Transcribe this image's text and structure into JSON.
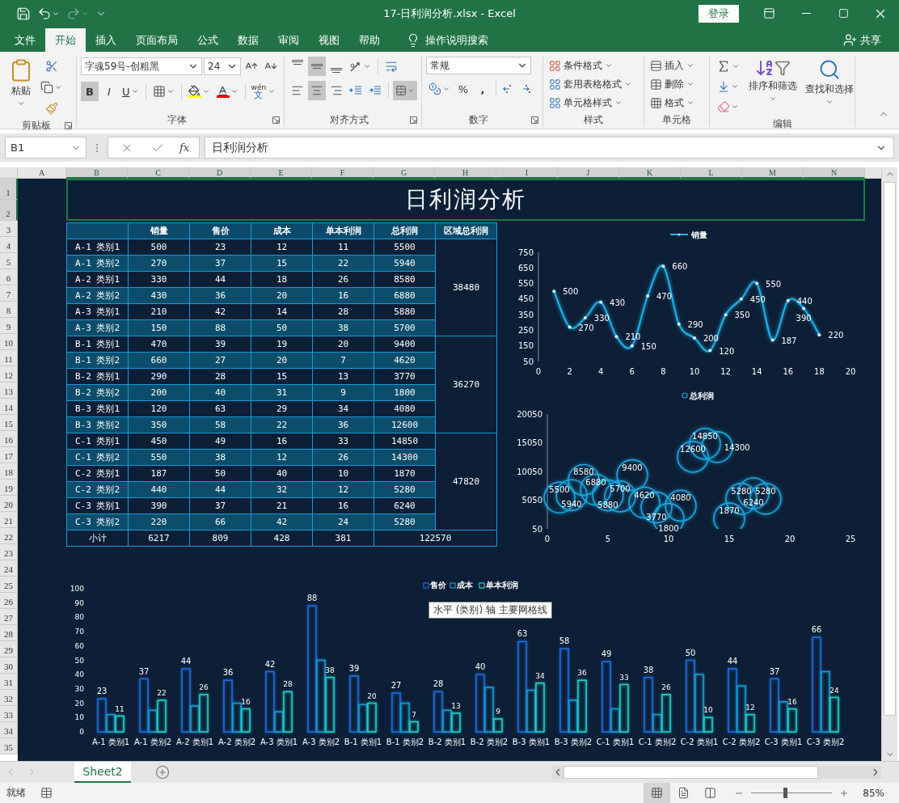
{
  "title_bar": {
    "title": "17-日利润分析.xlsx  -  Excel",
    "sign_in": "登录",
    "redo_disabled": true
  },
  "menu_tabs": [
    {
      "label": "文件",
      "selected": false
    },
    {
      "label": "开始",
      "selected": true
    },
    {
      "label": "插入",
      "selected": false
    },
    {
      "label": "页面布局",
      "selected": false
    },
    {
      "label": "公式",
      "selected": false
    },
    {
      "label": "数据",
      "selected": false
    },
    {
      "label": "审阅",
      "selected": false
    },
    {
      "label": "视图",
      "selected": false
    },
    {
      "label": "帮助",
      "selected": false
    }
  ],
  "tell_me": "操作说明搜索",
  "share": "共享",
  "ribbon": {
    "clipboard": {
      "label": "剪贴板",
      "paste": "粘贴"
    },
    "font": {
      "label": "字体",
      "font_name": "字魂59号-创粗黑",
      "font_size": "24",
      "styles": [
        {
          "label": "B",
          "kind": "bold",
          "selected": true
        },
        {
          "label": "I",
          "kind": "italic",
          "selected": false
        },
        {
          "label": "U",
          "kind": "underline",
          "selected": false
        }
      ],
      "phonetic": {
        "top": "wén",
        "bottom": "文"
      }
    },
    "alignment": {
      "label": "对齐方式",
      "vertical": [
        {
          "kind": "top",
          "selected": false
        },
        {
          "kind": "middle",
          "selected": true
        },
        {
          "kind": "bottom",
          "selected": false
        }
      ],
      "horizontal": [
        {
          "kind": "left",
          "selected": false
        },
        {
          "kind": "center",
          "selected": true
        },
        {
          "kind": "right",
          "selected": false
        }
      ],
      "merge_selected": true
    },
    "number": {
      "label": "数字",
      "format": "常规",
      "percent": "%",
      "comma": ","
    },
    "styles": {
      "label": "样式",
      "items": [
        "条件格式",
        "套用表格格式",
        "单元格样式"
      ]
    },
    "cells": {
      "label": "单元格",
      "items": [
        "插入",
        "删除",
        "格式"
      ]
    },
    "editing": {
      "label": "编辑",
      "sort": "排序和筛选",
      "find": "查找和选择"
    }
  },
  "formula_bar": {
    "name_box": "B1",
    "fx": "fx",
    "formula": "日利润分析"
  },
  "columns": [
    {
      "label": "A",
      "selected": false
    },
    {
      "label": "B",
      "selected": true
    },
    {
      "label": "C",
      "selected": true
    },
    {
      "label": "D",
      "selected": true
    },
    {
      "label": "E",
      "selected": true
    },
    {
      "label": "F",
      "selected": true
    },
    {
      "label": "G",
      "selected": true
    },
    {
      "label": "H",
      "selected": true
    },
    {
      "label": "I",
      "selected": true
    },
    {
      "label": "J",
      "selected": true
    },
    {
      "label": "K",
      "selected": true
    },
    {
      "label": "L",
      "selected": true
    },
    {
      "label": "M",
      "selected": true
    },
    {
      "label": "N",
      "selected": true
    }
  ],
  "rows": [
    {
      "label": "1",
      "selected": true
    },
    {
      "label": "2",
      "selected": true
    },
    {
      "label": "3",
      "selected": false
    },
    {
      "label": "4",
      "selected": false
    },
    {
      "label": "5",
      "selected": false
    },
    {
      "label": "6",
      "selected": false
    },
    {
      "label": "7",
      "selected": false
    },
    {
      "label": "8",
      "selected": false
    },
    {
      "label": "9",
      "selected": false
    },
    {
      "label": "10",
      "selected": false
    },
    {
      "label": "11",
      "selected": false
    },
    {
      "label": "12",
      "selected": false
    },
    {
      "label": "13",
      "selected": false
    },
    {
      "label": "14",
      "selected": false
    },
    {
      "label": "15",
      "selected": false
    },
    {
      "label": "16",
      "selected": false
    },
    {
      "label": "17",
      "selected": false
    },
    {
      "label": "18",
      "selected": false
    },
    {
      "label": "19",
      "selected": false
    },
    {
      "label": "20",
      "selected": false
    },
    {
      "label": "21",
      "selected": false
    },
    {
      "label": "22",
      "selected": false
    },
    {
      "label": "23",
      "selected": false
    },
    {
      "label": "24",
      "selected": false
    },
    {
      "label": "25",
      "selected": false
    },
    {
      "label": "26",
      "selected": false
    },
    {
      "label": "27",
      "selected": false
    },
    {
      "label": "28",
      "selected": false
    },
    {
      "label": "29",
      "selected": false
    },
    {
      "label": "30",
      "selected": false
    },
    {
      "label": "31",
      "selected": false
    },
    {
      "label": "32",
      "selected": false
    },
    {
      "label": "33",
      "selected": false
    },
    {
      "label": "34",
      "selected": false
    },
    {
      "label": "35",
      "selected": false
    }
  ],
  "sheet_title": {
    "text": "日利润分析",
    "selected": true
  },
  "table": {
    "columns": [
      "销量",
      "售价",
      "成本",
      "单本利润",
      "总利润",
      "区域总利润"
    ],
    "regions": [
      {
        "total": "38480",
        "rows": [
          {
            "label": "A-1 类别1",
            "values": [
              "500",
              "23",
              "12",
              "11",
              "5500"
            ]
          },
          {
            "label": "A-1 类别2",
            "values": [
              "270",
              "37",
              "15",
              "22",
              "5940"
            ]
          },
          {
            "label": "A-2 类别1",
            "values": [
              "330",
              "44",
              "18",
              "26",
              "8580"
            ]
          },
          {
            "label": "A-2 类别2",
            "values": [
              "430",
              "36",
              "20",
              "16",
              "6880"
            ]
          },
          {
            "label": "A-3 类别1",
            "values": [
              "210",
              "42",
              "14",
              "28",
              "5880"
            ]
          },
          {
            "label": "A-3 类别2",
            "values": [
              "150",
              "88",
              "50",
              "38",
              "5700"
            ]
          }
        ]
      },
      {
        "total": "36270",
        "rows": [
          {
            "label": "B-1 类别1",
            "values": [
              "470",
              "39",
              "19",
              "20",
              "9400"
            ]
          },
          {
            "label": "B-1 类别2",
            "values": [
              "660",
              "27",
              "20",
              "7",
              "4620"
            ]
          },
          {
            "label": "B-2 类别1",
            "values": [
              "290",
              "28",
              "15",
              "13",
              "3770"
            ]
          },
          {
            "label": "B-2 类别2",
            "values": [
              "200",
              "40",
              "31",
              "9",
              "1800"
            ]
          },
          {
            "label": "B-3 类别1",
            "values": [
              "120",
              "63",
              "29",
              "34",
              "4080"
            ]
          },
          {
            "label": "B-3 类别2",
            "values": [
              "350",
              "58",
              "22",
              "36",
              "12600"
            ]
          }
        ]
      },
      {
        "total": "47820",
        "rows": [
          {
            "label": "C-1 类别1",
            "values": [
              "450",
              "49",
              "16",
              "33",
              "14850"
            ]
          },
          {
            "label": "C-1 类别2",
            "values": [
              "550",
              "38",
              "12",
              "26",
              "14300"
            ]
          },
          {
            "label": "C-2 类别1",
            "values": [
              "187",
              "50",
              "40",
              "10",
              "1870"
            ]
          },
          {
            "label": "C-2 类别2",
            "values": [
              "440",
              "44",
              "32",
              "12",
              "5280"
            ]
          },
          {
            "label": "C-3 类别1",
            "values": [
              "390",
              "37",
              "21",
              "16",
              "6240"
            ]
          },
          {
            "label": "C-3 类别2",
            "values": [
              "220",
              "66",
              "42",
              "24",
              "5280"
            ]
          }
        ]
      }
    ],
    "footer": {
      "label": "小计",
      "values": [
        "6217",
        "809",
        "428",
        "381"
      ],
      "total": "122570"
    }
  },
  "charts": [
    {
      "chart_data": {
        "type": "line",
        "legend": "top",
        "x": [
          1,
          2,
          3,
          4,
          5,
          6,
          7,
          8,
          9,
          10,
          11,
          12,
          13,
          14,
          15,
          16,
          17,
          18
        ],
        "xlim": [
          0,
          20
        ],
        "ylim": [
          50,
          750
        ],
        "xticks": [
          0,
          2,
          4,
          6,
          8,
          10,
          12,
          14,
          16,
          18,
          20
        ],
        "yticks": [
          50,
          150,
          250,
          350,
          450,
          550,
          650,
          750
        ],
        "data_labels": true,
        "series": [
          {
            "name": "销量",
            "color": "#1fb4ee",
            "values": [
              500,
              270,
              330,
              430,
              210,
              150,
              470,
              660,
              290,
              200,
              120,
              350,
              450,
              550,
              187,
              440,
              390,
              220
            ]
          }
        ]
      }
    },
    {
      "chart_data": {
        "type": "scatter",
        "legend": "top",
        "x": [
          1,
          2,
          3,
          4,
          5,
          6,
          7,
          8,
          9,
          10,
          11,
          12,
          13,
          14,
          15,
          16,
          17,
          18
        ],
        "xlim": [
          0,
          25
        ],
        "ylim": [
          50,
          20050
        ],
        "xticks": [
          0,
          5,
          10,
          15,
          20,
          25
        ],
        "yticks": [
          50,
          5050,
          10050,
          15050,
          20050
        ],
        "data_labels": true,
        "series": [
          {
            "name": "总利润",
            "color": "#1aa6dc",
            "values": [
              5500,
              5940,
              8580,
              6880,
              5880,
              5700,
              9400,
              4620,
              3770,
              1800,
              4080,
              12600,
              14850,
              14300,
              1870,
              5280,
              6240,
              5280
            ]
          }
        ]
      }
    },
    {
      "chart_data": {
        "type": "bar",
        "legend": "top",
        "categories": [
          "A-1 类别1",
          "A-1 类别2",
          "A-2 类别1",
          "A-2 类别2",
          "A-3 类别1",
          "A-3 类别2",
          "B-1 类别1",
          "B-1 类别2",
          "B-2 类别1",
          "B-2 类别2",
          "B-3 类别1",
          "B-3 类别2",
          "C-1 类别1",
          "C-1 类别2",
          "C-2 类别1",
          "C-2 类别2",
          "C-3 类别1",
          "C-3 类别2"
        ],
        "ylim": [
          0,
          100
        ],
        "yticks": [
          0,
          10,
          20,
          30,
          40,
          50,
          60,
          70,
          80,
          90,
          100
        ],
        "series": [
          {
            "name": "售价",
            "color": "#1f6fe0",
            "values": [
              23,
              37,
              44,
              36,
              42,
              88,
              39,
              27,
              28,
              40,
              63,
              58,
              49,
              38,
              50,
              44,
              37,
              66
            ],
            "value_labels": [
              "23",
              "37",
              "44",
              "36",
              "42",
              "88",
              "39",
              "27",
              "28",
              "40",
              "63",
              "58",
              "49",
              "38",
              "50",
              "44",
              "37",
              "66"
            ]
          },
          {
            "name": "成本",
            "color": "#17a0d8",
            "values": [
              12,
              15,
              18,
              20,
              14,
              50,
              19,
              20,
              15,
              31,
              29,
              22,
              16,
              12,
              40,
              32,
              21,
              42
            ]
          },
          {
            "name": "单本利润",
            "color": "#1fd6cf",
            "values": [
              11,
              22,
              26,
              16,
              28,
              38,
              20,
              7,
              13,
              9,
              34,
              36,
              33,
              26,
              10,
              12,
              16,
              24
            ],
            "value_labels": [
              "11",
              "22",
              "26",
              "16",
              "28",
              "38",
              "20",
              "7",
              "13",
              "9",
              "34",
              "36",
              "33",
              "26",
              "10",
              "12",
              "16",
              "24"
            ]
          }
        ]
      }
    }
  ],
  "tooltip": "水平 (类别) 轴 主要网格线",
  "sheet_tabs": [
    {
      "label": "Sheet2",
      "selected": true
    }
  ],
  "status_bar": {
    "status": "就绪",
    "views": [
      {
        "kind": "normal",
        "selected": true
      },
      {
        "kind": "page_layout",
        "selected": false
      },
      {
        "kind": "page_break",
        "selected": false
      }
    ],
    "zoom": {
      "level": 0.42,
      "reading": "85%"
    }
  }
}
